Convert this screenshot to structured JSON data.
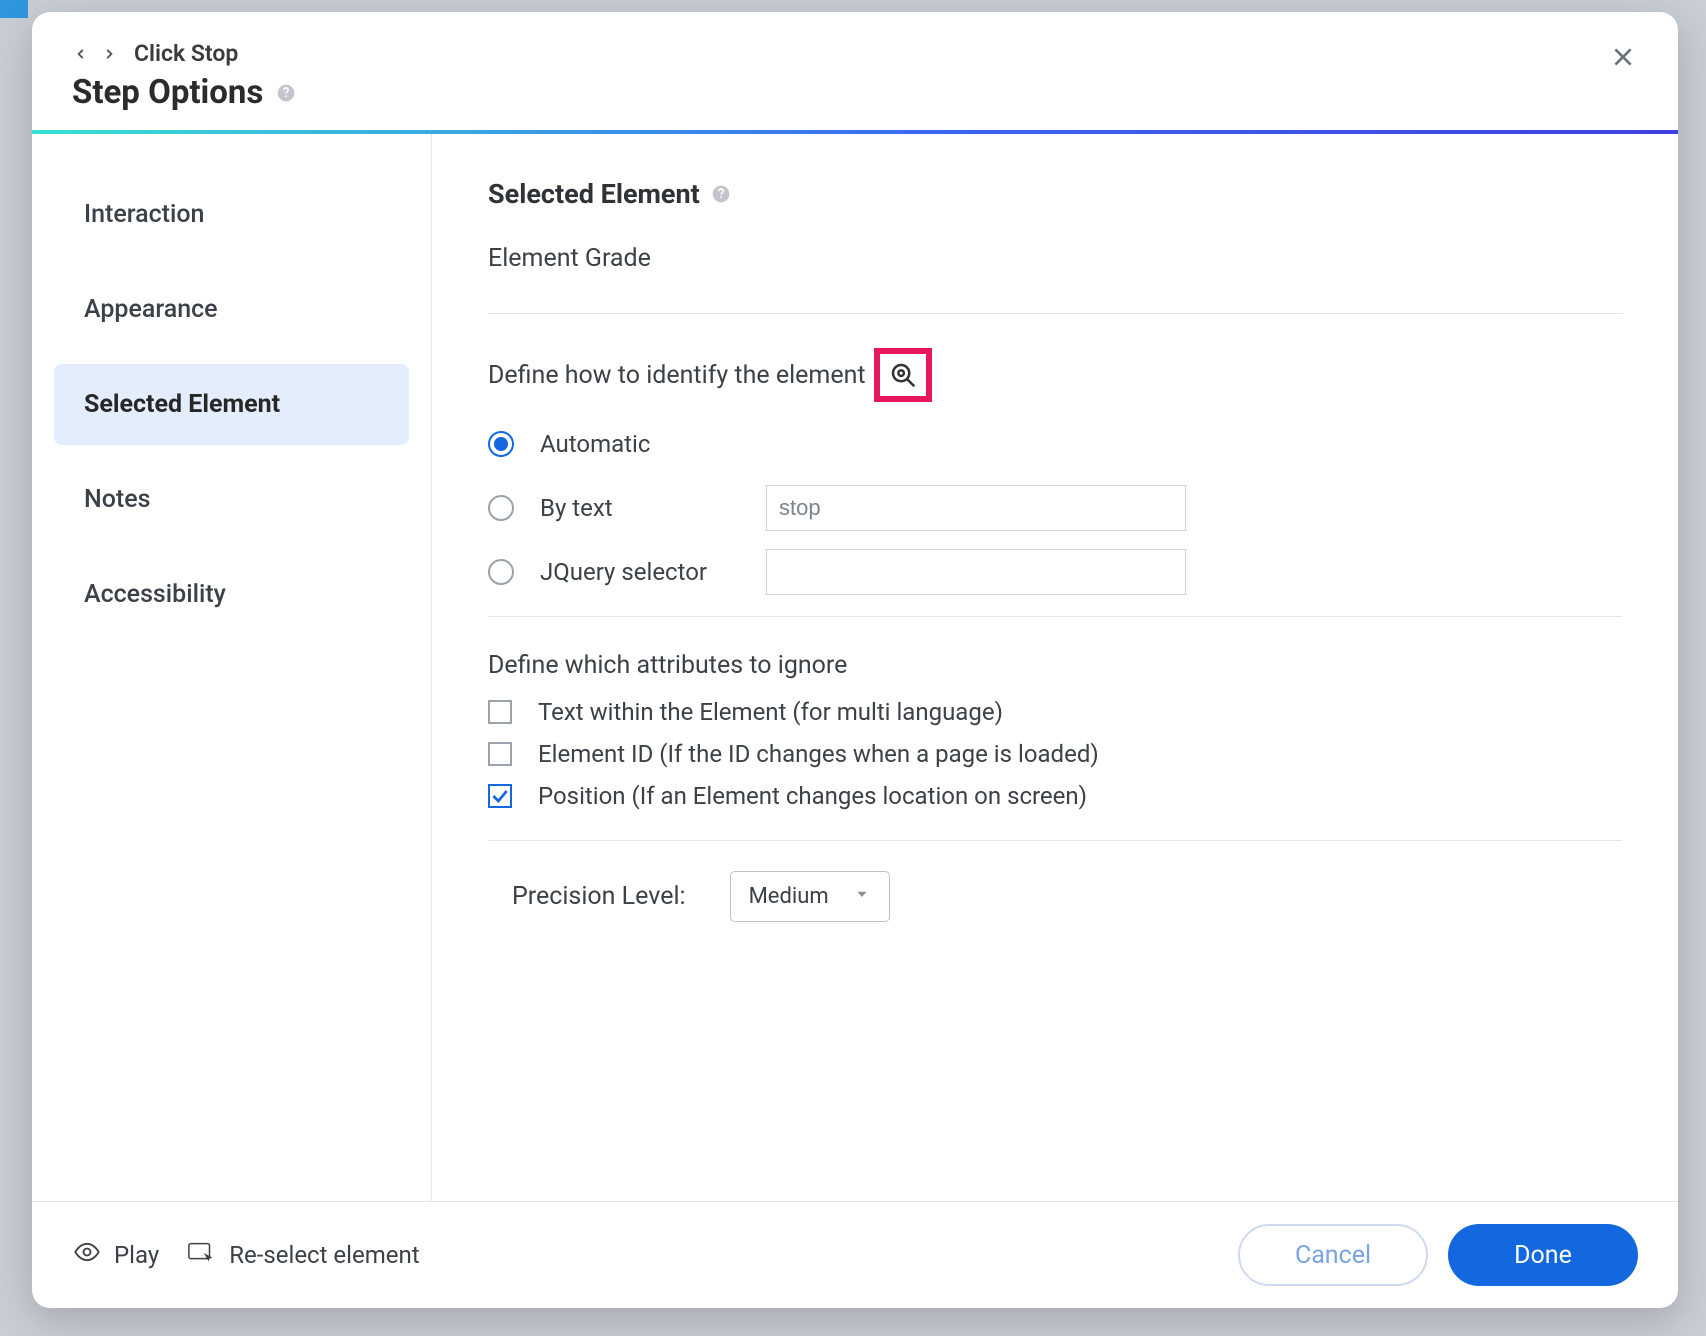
{
  "header": {
    "breadcrumb": "Click Stop",
    "title": "Step Options"
  },
  "sidebar": {
    "items": [
      {
        "label": "Interaction",
        "active": false
      },
      {
        "label": "Appearance",
        "active": false
      },
      {
        "label": "Selected Element",
        "active": true
      },
      {
        "label": "Notes",
        "active": false
      },
      {
        "label": "Accessibility",
        "active": false
      }
    ]
  },
  "main": {
    "section_title": "Selected Element",
    "element_grade_label": "Element Grade",
    "identify_label": "Define how to identify the element",
    "radios": {
      "automatic": "Automatic",
      "by_text": "By text",
      "jquery": "JQuery selector"
    },
    "by_text_value": "stop",
    "jquery_value": "",
    "ignore_header": "Define which attributes to ignore",
    "ignore_options": {
      "text_within": "Text within the Element (for multi language)",
      "element_id": "Element ID (If the ID changes when a page is loaded)",
      "position": "Position (If an Element changes location on screen)"
    },
    "ignore_checked": {
      "text_within": false,
      "element_id": false,
      "position": true
    },
    "precision_label": "Precision Level:",
    "precision_value": "Medium"
  },
  "footer": {
    "play": "Play",
    "reselect": "Re-select element",
    "cancel": "Cancel",
    "done": "Done"
  }
}
